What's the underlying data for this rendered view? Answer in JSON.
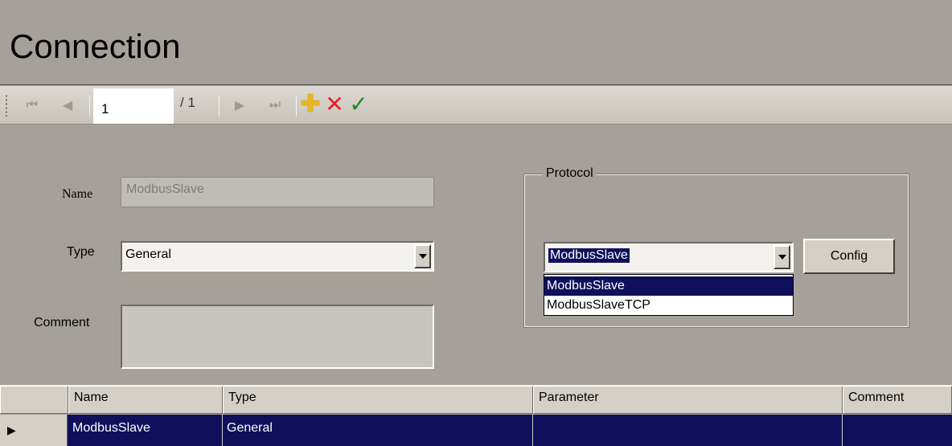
{
  "page": {
    "title": "Connection"
  },
  "navigator": {
    "current_page": "1",
    "total_pages": "/ 1",
    "icons": [
      "first-icon",
      "previous-icon",
      "next-icon",
      "last-icon",
      "add-icon",
      "delete-icon",
      "apply-icon"
    ],
    "glyphs": {
      "first": "⏮",
      "prev": "◀",
      "next": "▶",
      "last": "⏭",
      "add": "✚",
      "delete": "✕",
      "apply": "✓"
    }
  },
  "form": {
    "name_label": "Name",
    "name_value": "ModbusSlave",
    "type_label": "Type",
    "type_value": "General",
    "comment_label": "Comment",
    "comment_value": ""
  },
  "protocol": {
    "group_title": "Protocol",
    "selected": "ModbusSlave",
    "config_label": "Config",
    "options": [
      "ModbusSlave",
      "ModbusSlaveTCP"
    ],
    "highlighted_option": "ModbusSlave"
  },
  "grid": {
    "columns": [
      "Name",
      "Type",
      "Parameter",
      "Comment"
    ],
    "rows": [
      {
        "indicator": "▶",
        "name": "ModbusSlave",
        "type": "General",
        "parameter": "",
        "comment": ""
      }
    ],
    "selected_row_color": "#0f0f5c"
  },
  "colors": {
    "window_bg": "#a5a19a",
    "selection": "#0f0f5c",
    "add": "#e7b71d",
    "delete": "#e22222",
    "apply": "#1d8a1d"
  }
}
